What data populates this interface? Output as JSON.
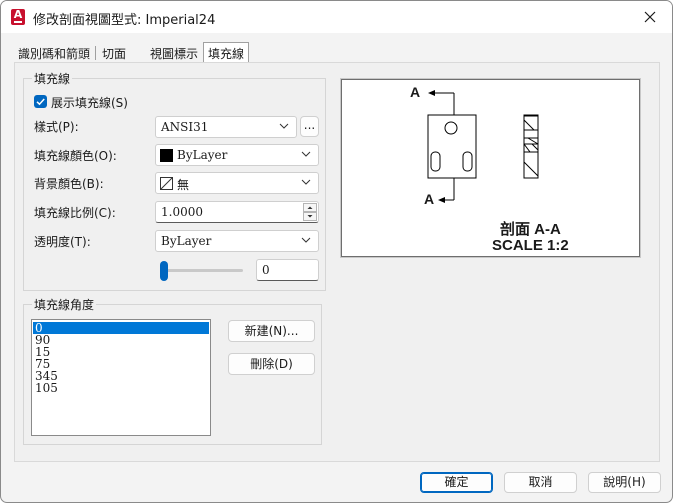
{
  "window": {
    "title": "修改剖面視圖型式: Imperial24"
  },
  "icons": {
    "app": "autocad-app-icon",
    "close": "close-icon"
  },
  "tabs": [
    {
      "label": "識別碼和箭頭",
      "active": false
    },
    {
      "label": "切面",
      "active": false
    },
    {
      "label": "視圖標示",
      "active": false
    },
    {
      "label": "填充線",
      "active": true
    }
  ],
  "hatch": {
    "group_title": "填充線",
    "show_hatch_label": "展示填充線(S)",
    "show_hatch_checked": true,
    "pattern_label": "樣式(P):",
    "pattern_value": "ANSI31",
    "browse_label": "...",
    "color_label": "填充線顏色(O):",
    "color_value": "ByLayer",
    "bg_color_label": "背景顏色(B):",
    "bg_color_value": "無",
    "scale_label": "填充線比例(C):",
    "scale_value": "1.0000",
    "transparency_label": "透明度(T):",
    "transparency_value": "ByLayer",
    "transparency_slider_value": "0"
  },
  "angles": {
    "group_title": "填充線角度",
    "items": [
      "0",
      "90",
      "15",
      "75",
      "345",
      "105"
    ],
    "selected_index": 0,
    "new_label": "新建(N)...",
    "delete_label": "刪除(D)"
  },
  "preview": {
    "label_top": "A",
    "label_bottom": "A",
    "caption_line1": "剖面 A-A",
    "caption_line2": "SCALE 1:2"
  },
  "footer": {
    "ok_label": "確定",
    "cancel_label": "取消",
    "help_label": "說明(H)"
  },
  "colors": {
    "accent": "#0067c0",
    "selected_row": "#0078d7",
    "brand": "#c8102e"
  }
}
